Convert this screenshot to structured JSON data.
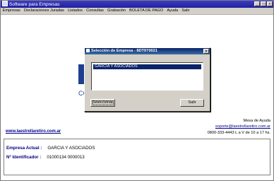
{
  "window": {
    "title": "Software para Empresas"
  },
  "menu": [
    "Empresas",
    "Declaraciones Juradas",
    "Listados",
    "Consultas",
    "Grabación",
    "BOLETA DE PAGO",
    "Ayuda",
    "Salir"
  ],
  "dialog": {
    "title": "Selección de Empresa - 8DT9?0021",
    "items": [
      "GARCIA Y ASOCIADOS"
    ],
    "select_label": "Seleccionar",
    "exit_label": "Salir"
  },
  "help": {
    "title": "Mesa de Ayuda",
    "email": "soporte@laestrellaretiro.com.ar",
    "phone": "0800-333-4443 L a V de 10 a 17 hs."
  },
  "website": "www.laestrellaretiro.com.ar",
  "company": {
    "current_label": "Empresa Actual :",
    "current_value": "GARCIA Y ASOCIADOS",
    "id_label": "Nº Identificador :",
    "id_value": "01000134 0000013"
  },
  "colors": {
    "titlebar": "#2020a0",
    "dialog_titlebar": "#0a2468",
    "selection": "#0a246a",
    "link": "#000088",
    "label": "#000080"
  }
}
